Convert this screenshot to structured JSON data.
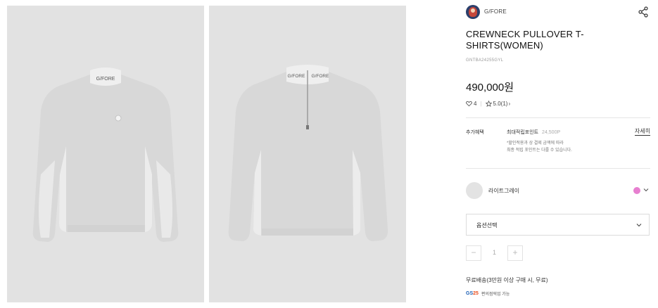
{
  "gallery": {
    "background": "#e2e2e2",
    "images": [
      {
        "alt": "front view",
        "collar_text": "G/FORE"
      },
      {
        "alt": "back view",
        "collar_text": "G/FORE"
      }
    ]
  },
  "product": {
    "brand": "G/FORE",
    "title": "CREWNECK PULLOVER T-SHIRTS(WOMEN)",
    "sku": "GNTBA24255GYL",
    "price": "490,000원",
    "likes": "4",
    "rating": "5.0(1)",
    "rating_suffix": "›"
  },
  "benefits": {
    "label": "추가혜택",
    "point_label": "최대적립포인트",
    "point_value": "24,500P",
    "more": "자세히",
    "note_line1": "*할인적용과 상 결제 금액에 따라",
    "note_line2": "최종 적립 포인트는 다를 수 있습니다."
  },
  "color": {
    "name": "라이트그레이",
    "dot_color": "#e77fd0",
    "swatch_color": "#e3e3e3"
  },
  "option": {
    "label": "옵션선택"
  },
  "quantity": {
    "minus": "−",
    "value": "1",
    "plus": "+"
  },
  "shipping": {
    "text": "무료배송(3만원 이상 구매 시, 무료)",
    "partner_logo_a": "GS",
    "partner_logo_b": "25",
    "partner_text": "편의점픽업 가능"
  },
  "icons": {
    "share": "share-icon",
    "heart": "heart-icon",
    "star": "star-icon",
    "chevron": "chevron-down-icon"
  }
}
